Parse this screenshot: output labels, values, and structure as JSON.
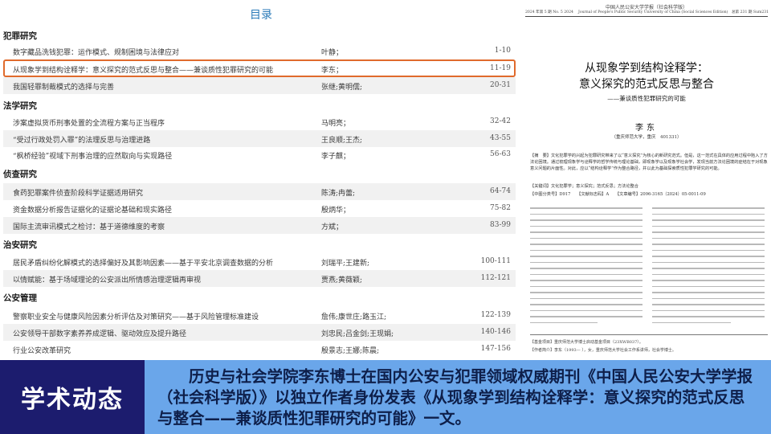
{
  "toc": {
    "title": "目录",
    "sections": [
      {
        "heading": "犯罪研究",
        "items": [
          {
            "title": "数字藏品洗钱犯罪：运作模式、规制困境与法律应对",
            "author": "叶静；",
            "pages": "1-10"
          },
          {
            "title": "从现象学到结构诠释学：意义探究的范式反思与整合——兼谈质性犯罪研究的可能",
            "author": "李东；",
            "pages": "11-19",
            "highlighted": true
          },
          {
            "title": "我国轻罪制裁模式的选择与完善",
            "author": "张继;黄明儒;",
            "pages": "20-31"
          }
        ]
      },
      {
        "heading": "法学研究",
        "items": [
          {
            "title": "涉案虚拟货币刑事处置的全流程方案与正当程序",
            "author": "马明亮；",
            "pages": "32-42"
          },
          {
            "title": "“受过行政处罚入罪”的法理反思与治理进路",
            "author": "王良顺;王杰;",
            "pages": "43-55"
          },
          {
            "title": "“枫桥经验”视域下刑事治理的应然取向与实现路径",
            "author": "李子麒；",
            "pages": "56-63"
          }
        ]
      },
      {
        "heading": "侦查研究",
        "items": [
          {
            "title": "食药犯罪案件侦查阶段科学证据适用研究",
            "author": "陈涛;冉蕾;",
            "pages": "64-74"
          },
          {
            "title": "资金数据分析报告证据化的证据论基础和现实路径",
            "author": "殷炳华；",
            "pages": "75-82"
          },
          {
            "title": "国际主流审讯模式之检讨：基于道德维度的考察",
            "author": "方斌；",
            "pages": "83-99"
          }
        ]
      },
      {
        "heading": "治安研究",
        "items": [
          {
            "title": "居民矛盾纠纷化解模式的选择偏好及其影响因素——基于平安北京调查数据的分析",
            "author": "刘瑞平;王建新;",
            "pages": "100-111"
          },
          {
            "title": "以情赋能：基于场域理论的公安派出所情感治理逻辑再审视",
            "author": "贾燕;黄薇颖;",
            "pages": "112-121"
          }
        ]
      },
      {
        "heading": "公安管理",
        "items": [
          {
            "title": "警察职业安全与健康风险因素分析评估及对策研究——基于风险管理标准建设",
            "author": "詹伟;康世庄;路玉江;",
            "pages": "122-139"
          },
          {
            "title": "公安领导干部数字素养养成逻辑、驱动效应及提升路径",
            "author": "刘忠民;吕金剑;王现娟;",
            "pages": "140-146"
          },
          {
            "title": "行业公安改革研究",
            "author": "殷景志;王娜;陈晨;",
            "pages": "147-156"
          }
        ]
      }
    ]
  },
  "article": {
    "journal_header": "中国人民公安大学学报（社会科学版）",
    "header_line": "2024 年第 5 期 No. 5 2024 　Journal of People's Public Security University of China (Social Sciences Edition)　总第 231 期 Sum231",
    "title_line1": "从现象学到结构诠释学：",
    "title_line2": "意义探究的范式反思与整合",
    "subtitle": "——兼谈质性犯罪研究的可能",
    "author": "李东",
    "affiliation": "（重庆师范大学，重庆　401331）",
    "abstract": "【摘　要】文化犯罪学的兴起为犯罪研究带来了以“意义探究”为核心的新研究范式。但是，这一范式在具体的应用过程中陷入了方法论困境。通过梳理现象学与诠释学的哲学传统与理论基础，即现象学以及现象学社会学，发现当前方法论困境的症结在于对现象意义问题的片面性。对此，应以“结构诠释学”作为整合路径，并以此为基础探索质性犯罪学研究的可能。",
    "keywords": "【关键词】文化犯罪学；意义探究；范式反思；方法论整合",
    "classification": "【中图分类号】D917　　【文献标志码】A　　【文章编号】2096-3165（2024）05-0011-09",
    "fund": "【基金项目】重庆师范大学博士启动基金项目（23XWB037）。",
    "author_info": "【作者简介】李东（1993— ），女，重庆师范大学社会工作系讲师，社会学博士。"
  },
  "banner": {
    "label": "学术动态",
    "text": "历史与社会学院李东博士在国内公安与犯罪领域权威期刊《中国人民公安大学学报（社会科学版）》以独立作者身份发表《从现象学到结构诠释学：意义探究的范式反思与整合——兼谈质性犯罪研究的可能》一文。"
  },
  "colors": {
    "toc_title": "#2a7ab8",
    "highlight_box": "#e06a2c",
    "banner_label_bg": "#1c1c6e",
    "banner_text_bg": "#6aa6ea",
    "banner_text": "#0e1f4a"
  }
}
